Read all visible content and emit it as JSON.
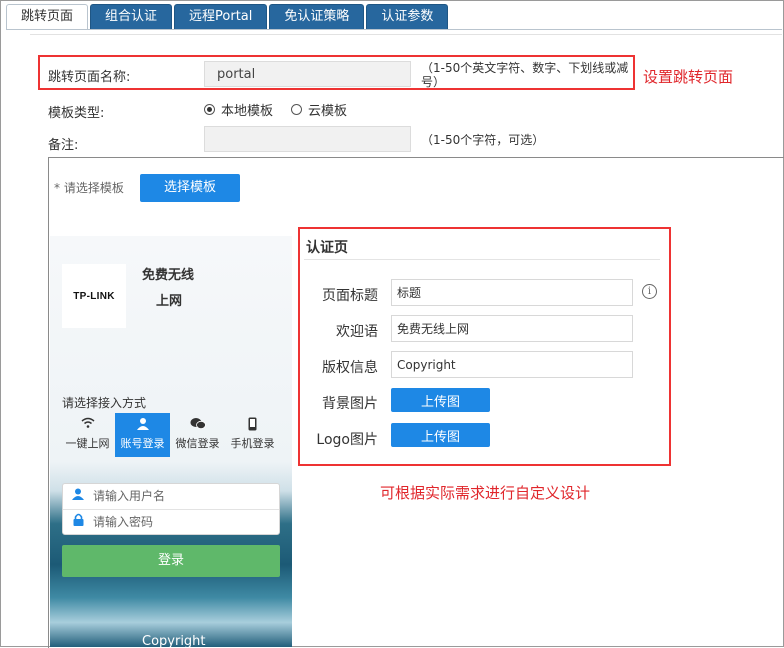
{
  "tabs": [
    {
      "label": "跳转页面"
    },
    {
      "label": "组合认证"
    },
    {
      "label": "远程Portal"
    },
    {
      "label": "免认证策略"
    },
    {
      "label": "认证参数"
    }
  ],
  "form": {
    "name_label": "跳转页面名称:",
    "name_value": "portal",
    "name_hint_1": "（1-50个英文字符、数字、下划线或减",
    "name_hint_2": "号）",
    "template_label": "模板类型:",
    "radio_local": "本地模板",
    "radio_cloud": "云模板",
    "note_label": "备注:",
    "note_value": "",
    "note_hint": "（1-50个字符，可选）",
    "select_template_label": "请选择模板",
    "select_template_required": "*",
    "select_template_button": "选择模板"
  },
  "annotations": {
    "set_page": "设置跳转页面",
    "custom_design": "可根据实际需求进行自定义设计",
    "accent": "#e0262b"
  },
  "preview": {
    "logo_text": "TP-LINK",
    "title_line1": "免费无线",
    "title_line2": "上网",
    "method_prompt": "请选择接入方式",
    "methods": [
      {
        "label": "一键上网",
        "icon": "wifi-icon"
      },
      {
        "label": "账号登录",
        "icon": "user-icon"
      },
      {
        "label": "微信登录",
        "icon": "wechat-icon"
      },
      {
        "label": "手机登录",
        "icon": "phone-icon"
      }
    ],
    "username_placeholder": "请输入用户名",
    "password_placeholder": "请输入密码",
    "login_button": "登录",
    "copyright": "Copyright"
  },
  "auth_page": {
    "section_title": "认证页",
    "page_title_label": "页面标题",
    "page_title_value": "标题",
    "welcome_label": "欢迎语",
    "welcome_value": "免费无线上网",
    "copyright_label": "版权信息",
    "copyright_value": "Copyright",
    "bg_label": "背景图片",
    "bg_button": "上传图",
    "logo_label": "Logo图片",
    "logo_button": "上传图"
  },
  "colors": {
    "tab_bg": "#27679e",
    "primary_button": "#1e88e5",
    "login_button": "#5fb86a",
    "annotation_red": "#e0262b"
  }
}
